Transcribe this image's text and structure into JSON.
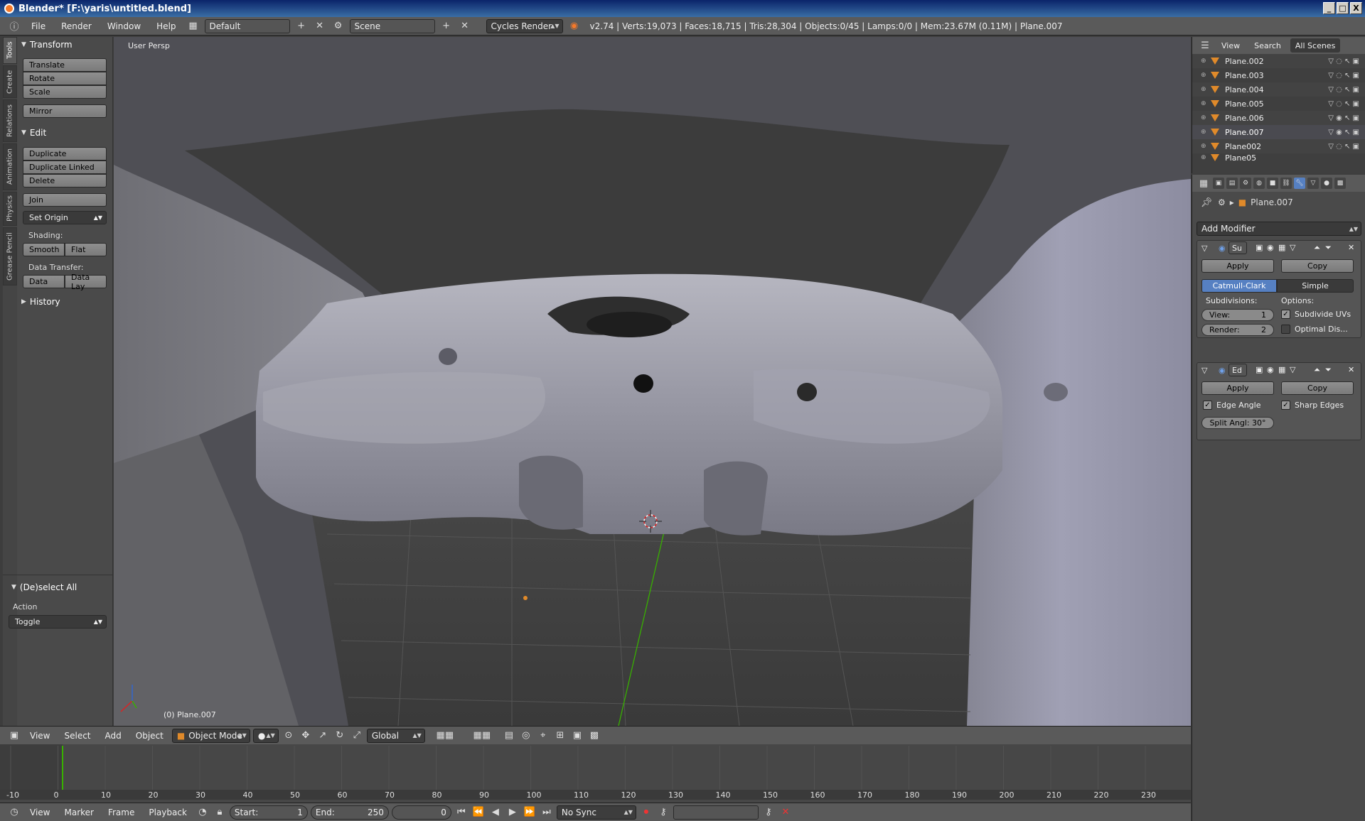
{
  "window": {
    "title": "Blender* [F:\\yaris\\untitled.blend]",
    "min": "_",
    "max": "□",
    "close": "X"
  },
  "info": {
    "menus": [
      "File",
      "Render",
      "Window",
      "Help"
    ],
    "layout": "Default",
    "scene": "Scene",
    "engine": "Cycles Render",
    "stats": "v2.74 | Verts:19,073 | Faces:18,715 | Tris:28,304 | Objects:0/45 | Lamps:0/0 | Mem:23.67M (0.11M) | Plane.007"
  },
  "shelf_tabs": [
    "Tools",
    "Create",
    "Relations",
    "Animation",
    "Physics",
    "Grease Pencil"
  ],
  "toolshelf": {
    "transform": {
      "title": "Transform",
      "buttons": [
        "Translate",
        "Rotate",
        "Scale",
        "Mirror"
      ]
    },
    "edit": {
      "title": "Edit",
      "buttons": [
        "Duplicate",
        "Duplicate Linked",
        "Delete",
        "Join"
      ],
      "set_origin": "Set Origin",
      "shading_label": "Shading:",
      "smooth": "Smooth",
      "flat": "Flat",
      "data_transfer_label": "Data Transfer:",
      "data": "Data",
      "data_lay": "Data Lay"
    },
    "history": {
      "title": "History"
    },
    "deselect": {
      "title": "(De)select All",
      "action_label": "Action",
      "action_value": "Toggle"
    }
  },
  "viewport": {
    "label": "User Persp",
    "object_name": "(0) Plane.007"
  },
  "view3d_header": {
    "menus": [
      "View",
      "Select",
      "Add",
      "Object"
    ],
    "mode": "Object Mode",
    "orientation": "Global"
  },
  "timeline": {
    "ticks": [
      "-10",
      "0",
      "10",
      "20",
      "30",
      "40",
      "50",
      "60",
      "70",
      "80",
      "90",
      "100",
      "110",
      "120",
      "130",
      "140",
      "150",
      "160",
      "170",
      "180",
      "190",
      "200",
      "210",
      "220",
      "230"
    ],
    "current_frame_value": 0,
    "menus": [
      "View",
      "Marker",
      "Frame",
      "Playback"
    ],
    "start_label": "Start:",
    "start": "1",
    "end_label": "End:",
    "end": "250",
    "current": "0",
    "sync": "No Sync"
  },
  "outliner": {
    "view": "View",
    "search": "Search",
    "scenes": "All Scenes",
    "items": [
      "Plane.002",
      "Plane.003",
      "Plane.004",
      "Plane.005",
      "Plane.006",
      "Plane.007",
      "Plane002",
      "Plane05"
    ]
  },
  "properties": {
    "object_name": "Plane.007",
    "add_modifier": "Add Modifier",
    "subsurf": {
      "short": "Su",
      "apply": "Apply",
      "copy": "Copy",
      "catmull": "Catmull-Clark",
      "simple": "Simple",
      "subdivisions_label": "Subdivisions:",
      "options_label": "Options:",
      "view_label": "View:",
      "view_value": "1",
      "render_label": "Render:",
      "render_value": "2",
      "subdivide_uvs": "Subdivide UVs",
      "optimal": "Optimal Dis..."
    },
    "edgesplit": {
      "short": "Ed",
      "apply": "Apply",
      "copy": "Copy",
      "edge_angle": "Edge Angle",
      "sharp_edges": "Sharp Edges",
      "split_angle": "Split Angl: 30°"
    }
  },
  "colors": {
    "accent": "#5680c2",
    "object_orange": "#e08a2a",
    "frame_green": "#38b000"
  }
}
